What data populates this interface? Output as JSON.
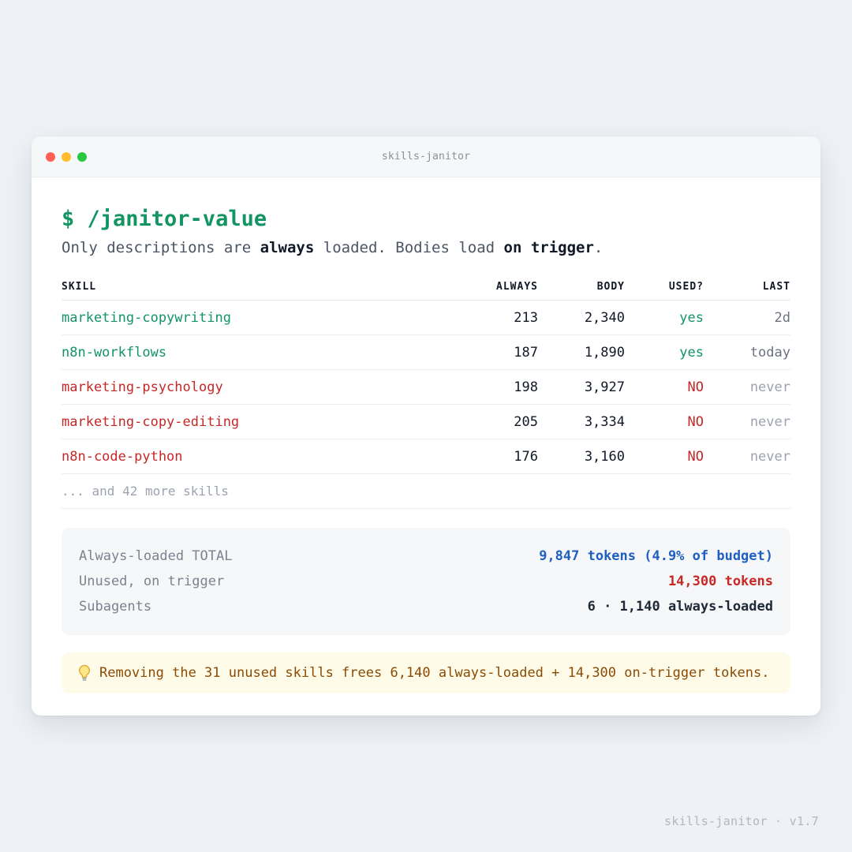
{
  "window": {
    "title": "skills-janitor"
  },
  "header": {
    "command": "$ /janitor-value",
    "subtitle_parts": [
      "Only descriptions are ",
      "always",
      " loaded. Bodies load ",
      "on trigger",
      "."
    ]
  },
  "table": {
    "columns": [
      "SKILL",
      "ALWAYS",
      "BODY",
      "USED?",
      "LAST"
    ],
    "rows": [
      {
        "skill": "marketing-copywriting",
        "always": "213",
        "body": "2,340",
        "used": "yes",
        "last": "2d"
      },
      {
        "skill": "n8n-workflows",
        "always": "187",
        "body": "1,890",
        "used": "yes",
        "last": "today"
      },
      {
        "skill": "marketing-psychology",
        "always": "198",
        "body": "3,927",
        "used": "NO",
        "last": "never"
      },
      {
        "skill": "marketing-copy-editing",
        "always": "205",
        "body": "3,334",
        "used": "NO",
        "last": "never"
      },
      {
        "skill": "n8n-code-python",
        "always": "176",
        "body": "3,160",
        "used": "NO",
        "last": "never"
      }
    ],
    "more": "... and 42 more skills"
  },
  "summary": {
    "always_label": "Always-loaded TOTAL",
    "always_value": "9,847 tokens (4.9% of budget)",
    "unused_label": "Unused, on trigger",
    "unused_value": "14,300 tokens",
    "subagents_label": "Subagents",
    "subagents_value": "6 · 1,140 always-loaded"
  },
  "tip": {
    "icon": "lightbulb-icon",
    "text": "Removing the 31 unused skills frees 6,140 always-loaded + 14,300 on-trigger tokens."
  },
  "footer": {
    "text": "skills-janitor · v1.7"
  },
  "colors": {
    "used_green": "#129464",
    "unused_red": "#c62828",
    "accent_blue": "#1f5fbf",
    "tip_text": "#8a4b06"
  }
}
